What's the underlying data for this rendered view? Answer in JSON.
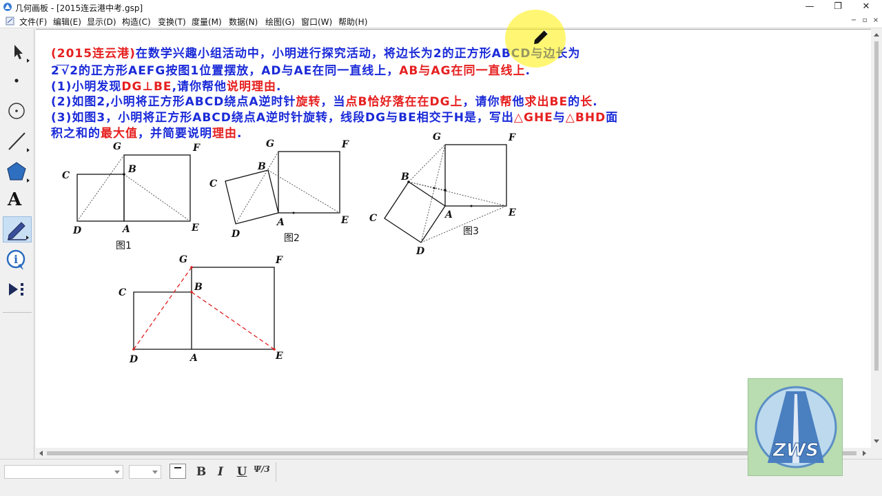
{
  "window": {
    "title": "几何画板 - [2015连云港中考.gsp]",
    "min_glyph": "—",
    "max_glyph": "❐",
    "close_glyph": "✕"
  },
  "menu": {
    "items": [
      "文件(F)",
      "编辑(E)",
      "显示(D)",
      "构造(C)",
      "变换(T)",
      "度量(M)",
      "数据(N)",
      "绘图(G)",
      "窗口(W)",
      "帮助(H)"
    ],
    "mdi_min": "−",
    "mdi_restore": "▫",
    "mdi_close": "×"
  },
  "toolbox": {
    "tools": [
      "arrow-select-tool",
      "point-tool",
      "compass-tool",
      "straightedge-tool",
      "polygon-tool",
      "text-tool",
      "marker-tool",
      "information-tool",
      "custom-tool"
    ],
    "selected": "marker-tool",
    "text_tool_glyph": "A"
  },
  "problem": {
    "line1": {
      "source": "(2015连云港)",
      "text": "在数学兴趣小组活动中，小明进行探究活动，将边长为2的正方形ABCD与边长为"
    },
    "line2": {
      "t1": "2",
      "radicand": "2",
      "t2": "的正方形AEFG按图1位置摆放，AD与AE在同一直线上，",
      "t3": "AB与AG在同一直线上",
      "t4": "."
    },
    "line3": {
      "t1": "(1)小明发现",
      "t2": "DG⊥BE",
      "t3": ",请你帮他",
      "t4": "说明理由",
      "t5": "."
    },
    "line4": {
      "t1": "(2)如图2,小明将正方形ABCD绕点A逆时针",
      "t2": "旋转",
      "t3": "，当",
      "t4": "点B恰好落在在DG上",
      "t5": "，请你",
      "t6": "帮",
      "t7": "他",
      "t8": "求出",
      "t9": "BE",
      "t10": "的",
      "t11": "长",
      "t12": "."
    },
    "line5": {
      "t1": "(3)如图3，小明将正方形ABCD绕点A逆时针旋转，线段DG与BE相交于H是，写出",
      "t2": "△GHE",
      "t3": "与",
      "t4": "△BHD",
      "t5": "面"
    },
    "line6": {
      "t1": "积之和的",
      "t2": "最大值",
      "t3": "，并简要说明",
      "t4": "理由",
      "t5": "."
    }
  },
  "figures": {
    "fig1": {
      "caption": "图1",
      "labels": {
        "G": "G",
        "F": "F",
        "C": "C",
        "B": "B",
        "D": "D",
        "A": "A",
        "E": "E"
      }
    },
    "fig2": {
      "caption": "图2",
      "labels": {
        "G": "G",
        "F": "F",
        "B": "B",
        "C": "C",
        "A": "A",
        "D": "D",
        "E": "E"
      }
    },
    "fig3": {
      "caption": "图3",
      "labels": {
        "G": "G",
        "F": "F",
        "B": "B",
        "C": "C",
        "A": "A",
        "E": "E",
        "D": "D"
      }
    },
    "fig4": {
      "labels": {
        "G": "G",
        "F": "F",
        "C": "C",
        "B": "B",
        "D": "D",
        "A": "A",
        "E": "E"
      }
    }
  },
  "format_bar": {
    "font_value": "",
    "size_value": "",
    "bold": "B",
    "italic": "I",
    "underline": "U",
    "math_format": "Ψ/3"
  },
  "watermark": {
    "text": "ZWS"
  },
  "colors": {
    "text_blue": "#1a2ad8",
    "text_red": "#e62020",
    "cursor_highlight": "#fff000",
    "watermark_bg": "#b9dcb0"
  }
}
